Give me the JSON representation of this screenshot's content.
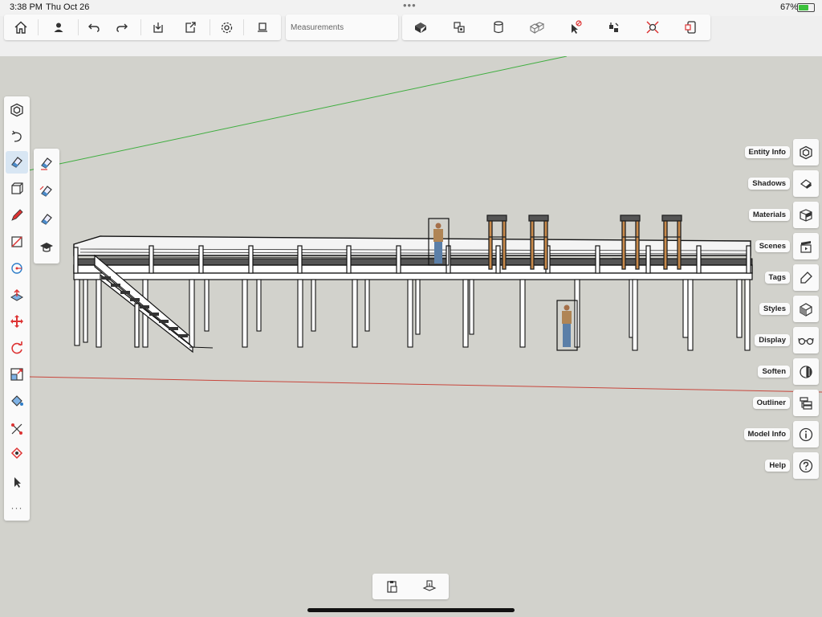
{
  "status_bar": {
    "time": "3:38 PM",
    "date": "Thu Oct 26",
    "battery_percent": "67%",
    "battery_level": 0.67,
    "multitask_dots": "•••"
  },
  "toolbar": {
    "measurements_placeholder": "Measurements",
    "left_group_icons": [
      "home-icon",
      "account-icon",
      "undo-icon",
      "redo-icon",
      "import-icon",
      "export-icon",
      "settings-icon",
      "pencil-stylus-icon"
    ],
    "right_group_icons": [
      "view-mode-icon",
      "scene-icon",
      "cylinder-icon",
      "components-icon",
      "select-off-icon",
      "solid-tools-icon",
      "zoom-extents-icon",
      "ar-icon"
    ]
  },
  "left_toolbar": {
    "tools": [
      "outer-shell-icon",
      "orbit-icon",
      "eraser-icon",
      "push-pull-box-icon",
      "pencil-icon",
      "line-icon",
      "circle-tape-icon",
      "push-pull-icon",
      "move-icon",
      "rotate-icon",
      "scale-icon",
      "paint-bucket-icon",
      "dimension-icon",
      "section-icon",
      "select-icon"
    ],
    "active_tool": "eraser-icon",
    "more_label": "···"
  },
  "eraser_flyout": {
    "tools": [
      "eraser-icon",
      "soften-eraser-icon",
      "hide-eraser-icon",
      "eraser-help-icon"
    ]
  },
  "right_panels": [
    {
      "label": "Entity Info",
      "icon": "entity-info-icon"
    },
    {
      "label": "Shadows",
      "icon": "shadows-icon"
    },
    {
      "label": "Materials",
      "icon": "materials-icon"
    },
    {
      "label": "Scenes",
      "icon": "scenes-icon"
    },
    {
      "label": "Tags",
      "icon": "tags-icon"
    },
    {
      "label": "Styles",
      "icon": "styles-icon"
    },
    {
      "label": "Display",
      "icon": "display-icon"
    },
    {
      "label": "Soften",
      "icon": "soften-icon"
    },
    {
      "label": "Outliner",
      "icon": "outliner-icon"
    },
    {
      "label": "Model Info",
      "icon": "model-info-icon"
    },
    {
      "label": "Help",
      "icon": "help-icon"
    }
  ],
  "bottom_bar": {
    "icons": [
      "paste-icon",
      "copy-to-scene-icon"
    ]
  },
  "colors": {
    "canvas_background": "#d2d2cc",
    "active_tool_background": "#d8e6f3",
    "green_axis": "#3fae3f",
    "red_axis": "#c8463c",
    "battery_fill": "#3cc13c"
  }
}
